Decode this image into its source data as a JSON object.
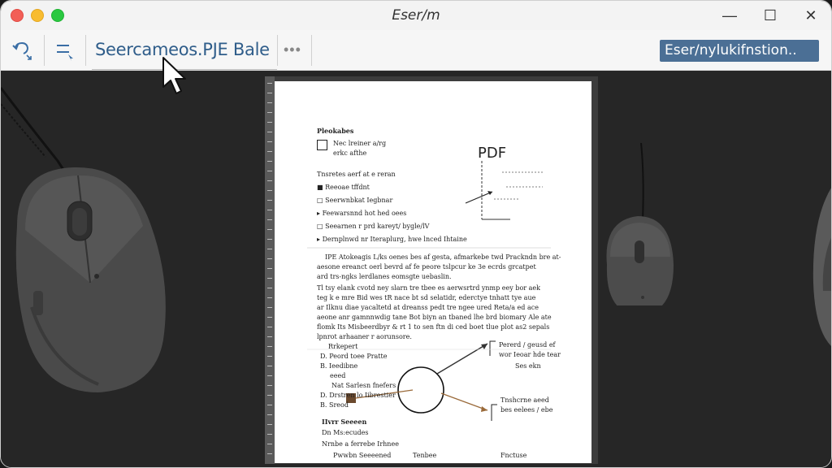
{
  "window": {
    "title": "Eser/m"
  },
  "toolbar": {
    "tab_title": "Seercameos.PJE Bale",
    "more_label": "•••",
    "badge_text": "Eser/nylukifnstion.."
  },
  "window_controls": {
    "minimize": "—",
    "maximize": "☐",
    "close": "✕"
  },
  "document": {
    "heading": "Pleokabes",
    "intro_1": "Nec lreiner a/rg",
    "intro_2": "erkc afthe",
    "list_title": "Tnsretes aerf at e reran",
    "items": [
      "Reeoae tffdnt",
      "Seerwnbkat Iegbnar",
      "Feewarsnnd hot hed oees",
      "Seearnen r prd kareyt/ bygle/lV",
      "Dernplnwd nr Iteraplurg, hwe lnced Ihtaine"
    ],
    "pdf_label": "PDF",
    "para_1": "IPE Atokeagis L/ks oenes bes af gesta, afmarkebe twd Prackndn bre at-",
    "para_2": "aesone ereanct oerl bevrd af fe peore tslpcur ke 3e ecrds grcatpet",
    "para_3": "ard trs-ngks lerdlanes eomsgte uebaslin.",
    "para_4": "Tl tsy elank cvotd ney slarn tre tbee es aerwsrtrd ynmp eey bor aek",
    "para_5": "teg k e mre Bid wes tR nace bt sd selatidr, ederctye tnhatt tye aue",
    "para_6": "ar Ilknu diae yacaltetd at dreanss pedt tre ngee ured Reta/a ed ace",
    "para_7": "aeone anr gamnnwdig tane Bot biyn an tbaned lhe brd biomary Ale ate",
    "para_8": "flomk Its Misbeerdbyr & rt 1 to sen ftn di ced boet tlue plot as2 sepals",
    "para_9": "lpnrot arhaaner r aorunsore.",
    "sub_items": [
      "Rrkepert",
      "Peord toee Pratte",
      "Ieedibne",
      "eeed",
      "Nat Sarlesn fnefers",
      "Drstren lo Iibrestier",
      "Sreod"
    ],
    "callout_1": "Pererd / geusd ef",
    "callout_1b": "wor Ieoar hde tear",
    "callout_1c": "Ses ekn",
    "callout_2": "Tnshcrne aeed",
    "callout_2b": "bes eelees / ebe",
    "bottom_title": "IIvrr Seeeen",
    "bottom_1": "Dn Ms:ecudes",
    "bottom_2": "Nrnbe a ferrebe Irhnee",
    "bottom_3": "Pwwbn Seeeened",
    "bottom_4": "Tenbee",
    "bottom_5": "Fnctuse"
  }
}
